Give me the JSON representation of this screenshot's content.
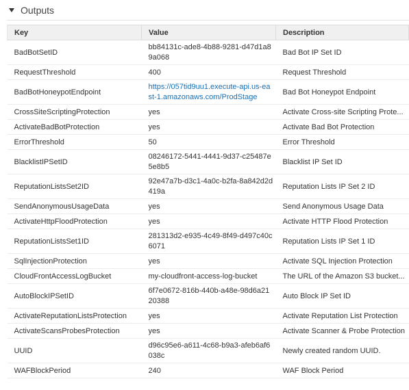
{
  "section": {
    "title": "Outputs"
  },
  "table": {
    "columns": [
      "Key",
      "Value",
      "Description"
    ],
    "rows": [
      {
        "key": "BadBotSetID",
        "value": "bb84131c-ade8-4b88-9281-d47d1a89a068",
        "description": "Bad Bot IP Set ID",
        "tall": true
      },
      {
        "key": "RequestThreshold",
        "value": "400",
        "description": "Request Threshold"
      },
      {
        "key": "BadBotHoneypotEndpoint",
        "value": "https://057tid9uu1.execute-api.us-east-1.amazonaws.com/ProdStage",
        "description": "Bad Bot Honeypot Endpoint",
        "tall": true,
        "link": true
      },
      {
        "key": "CrossSiteScriptingProtection",
        "value": "yes",
        "description": "Activate Cross-site Scripting Prote..."
      },
      {
        "key": "ActivateBadBotProtection",
        "value": "yes",
        "description": "Activate Bad Bot Protection"
      },
      {
        "key": "ErrorThreshold",
        "value": "50",
        "description": "Error Threshold"
      },
      {
        "key": "BlacklistIPSetID",
        "value": "08246172-5441-4441-9d37-c25487e5e8b5",
        "description": "Blacklist IP Set ID",
        "tall": true
      },
      {
        "key": "ReputationListsSet2ID",
        "value": "92e47a7b-d3c1-4a0c-b2fa-8a842d2d419a",
        "description": "Reputation Lists IP Set 2 ID",
        "tall": true
      },
      {
        "key": "SendAnonymousUsageData",
        "value": "yes",
        "description": "Send Anonymous Usage Data"
      },
      {
        "key": "ActivateHttpFloodProtection",
        "value": "yes",
        "description": "Activate HTTP Flood Protection"
      },
      {
        "key": "ReputationListsSet1ID",
        "value": "281313d2-e935-4c49-8f49-d497c40c6071",
        "description": "Reputation Lists IP Set 1 ID",
        "tall": true
      },
      {
        "key": "SqlInjectionProtection",
        "value": "yes",
        "description": "Activate SQL Injection Protection"
      },
      {
        "key": "CloudFrontAccessLogBucket",
        "value": "my-cloudfront-access-log-bucket",
        "description": "The URL of the Amazon S3 bucket..."
      },
      {
        "key": "AutoBlockIPSetID",
        "value": "6f7e0672-816b-440b-a48e-98d6a2120388",
        "description": "Auto Block IP Set ID",
        "tall": true
      },
      {
        "key": "ActivateReputationListsProtection",
        "value": "yes",
        "description": "Activate Reputation List Protection"
      },
      {
        "key": "ActivateScansProbesProtection",
        "value": "yes",
        "description": "Activate Scanner & Probe Protection"
      },
      {
        "key": "UUID",
        "value": "d96c95e6-a611-4c68-b9a3-afeb6af6038c",
        "description": "Newly created random UUID.",
        "tall": true
      },
      {
        "key": "WAFBlockPeriod",
        "value": "240",
        "description": "WAF Block Period"
      }
    ]
  },
  "colors": {
    "link": "#1a6fb5",
    "header_bg": "#f0f0f0"
  },
  "icons": {
    "collapse": "caret-down-icon"
  }
}
